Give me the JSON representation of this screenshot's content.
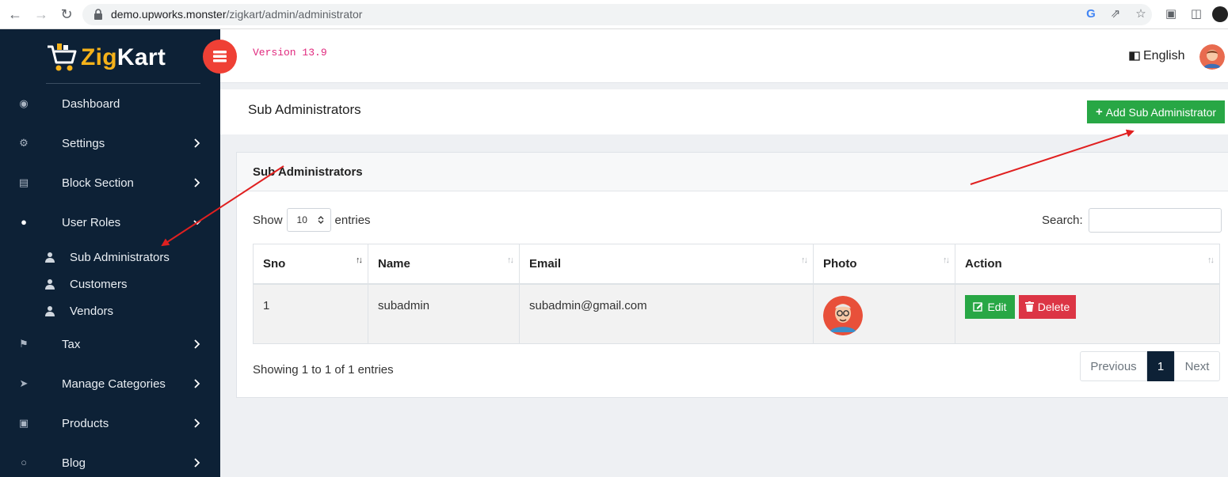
{
  "browser": {
    "url_host": "demo.upworks.monster",
    "url_path": "/zigkart/admin/administrator"
  },
  "brand": {
    "prefix": "Zig",
    "suffix": "Kart"
  },
  "sidebar": {
    "items": [
      {
        "label": "Dashboard",
        "icon": "dashboard-icon"
      },
      {
        "label": "Settings",
        "icon": "gears-icon"
      },
      {
        "label": "Block Section",
        "icon": "file-icon"
      },
      {
        "label": "User Roles",
        "icon": "users-icon"
      },
      {
        "label": "Tax",
        "icon": "flag-icon"
      },
      {
        "label": "Manage Categories",
        "icon": "location-arrow-icon"
      },
      {
        "label": "Products",
        "icon": "cart-icon"
      },
      {
        "label": "Blog",
        "icon": "comments-icon"
      }
    ],
    "sub_items": [
      {
        "label": "Sub Administrators",
        "icon": "user-icon"
      },
      {
        "label": "Customers",
        "icon": "user-icon"
      },
      {
        "label": "Vendors",
        "icon": "user-icon"
      }
    ]
  },
  "header": {
    "version": "Version 13.9",
    "language": "English"
  },
  "page": {
    "title": "Sub Administrators",
    "add_button": "Add Sub Administrator"
  },
  "card": {
    "title": "Sub Administrators",
    "show_label": "Show",
    "entries_label": "entries",
    "page_length": "10",
    "search_label": "Search:",
    "search_value": "",
    "columns": [
      "Sno",
      "Name",
      "Email",
      "Photo",
      "Action"
    ],
    "rows": [
      {
        "sno": "1",
        "name": "subadmin",
        "email": "subadmin@gmail.com",
        "edit_label": "Edit",
        "delete_label": "Delete"
      }
    ],
    "info": "Showing 1 to 1 of 1 entries",
    "pagination": {
      "previous": "Previous",
      "current": "1",
      "next": "Next"
    }
  },
  "colors": {
    "sidebar_bg": "#0d2136",
    "brand_accent": "#f5b21a",
    "toggle_red": "#ef4035",
    "success": "#28a745",
    "danger": "#dc3545",
    "version_pink": "#e0287d",
    "annotation_arrow": "#e02020"
  }
}
